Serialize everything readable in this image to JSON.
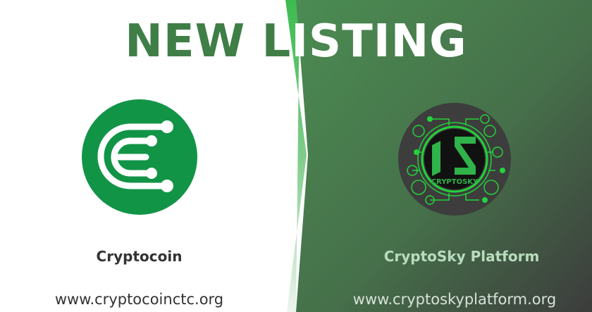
{
  "title": "NEW LISTING",
  "left": {
    "name": "Cryptocoin",
    "url": "www.cryptocoinctc.org",
    "logo_color": "#129447"
  },
  "right": {
    "name": "CryptoSky Platform",
    "url": "www.cryptoskyplatform.org",
    "logo_text": "CRYPTOSKY"
  },
  "colors": {
    "title_green": "#3f7e47",
    "accent": "#3dbb4f"
  }
}
